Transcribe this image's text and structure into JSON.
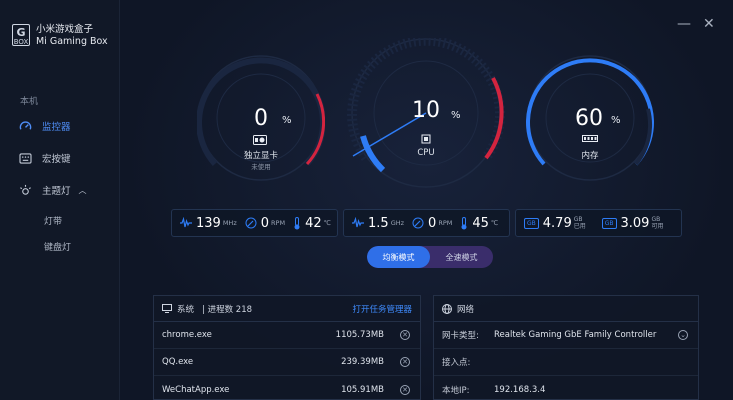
{
  "app": {
    "title_cn": "小米游戏盒子",
    "title_en": "Mi Gaming Box",
    "logo_top": "G",
    "logo_bottom": "BOX"
  },
  "window": {
    "minimize": "—",
    "close": "✕"
  },
  "sidebar": {
    "section": "本机",
    "items": [
      {
        "label": "监控器",
        "icon": "speedometer-icon",
        "active": true
      },
      {
        "label": "宏按键",
        "icon": "keyboard-icon",
        "active": false
      },
      {
        "label": "主题灯",
        "icon": "light-icon",
        "active": false,
        "expanded": true
      }
    ],
    "sub_items": [
      "灯带",
      "键盘灯"
    ]
  },
  "gauges": {
    "gpu": {
      "value": "0",
      "unit": "%",
      "label": "独立显卡",
      "sublabel": "未使用",
      "percent": 0
    },
    "cpu": {
      "value": "10",
      "unit": "%",
      "label": "CPU",
      "percent": 10
    },
    "mem": {
      "value": "60",
      "unit": "%",
      "label": "内存",
      "percent": 60
    }
  },
  "stats": {
    "gpu": {
      "freq": "139",
      "freq_unit": "MHz",
      "rpm": "0",
      "rpm_unit": "RPM",
      "temp": "42",
      "temp_unit": "℃"
    },
    "cpu": {
      "freq": "1.5",
      "freq_unit": "GHz",
      "rpm": "0",
      "rpm_unit": "RPM",
      "temp": "45",
      "temp_unit": "℃"
    },
    "mem": {
      "used": "4.79",
      "used_unit_top": "GB",
      "used_unit_bottom": "已用",
      "avail": "3.09",
      "avail_unit_top": "GB",
      "avail_unit_bottom": "可用",
      "badge": "GB"
    }
  },
  "modes": {
    "balanced": "均衡模式",
    "full": "全速模式"
  },
  "system_panel": {
    "title": "系统",
    "process_label": "| 进程数 218",
    "link": "打开任务管理器",
    "processes": [
      {
        "name": "chrome.exe",
        "mem": "1105.73MB"
      },
      {
        "name": "QQ.exe",
        "mem": "239.39MB"
      },
      {
        "name": "WeChatApp.exe",
        "mem": "105.91MB"
      }
    ]
  },
  "network_panel": {
    "title": "网络",
    "rows": [
      {
        "key": "网卡类型:",
        "value": "Realtek Gaming GbE Family Controller"
      },
      {
        "key": "接入点:",
        "value": ""
      },
      {
        "key": "本地IP:",
        "value": "192.168.3.4"
      }
    ]
  },
  "colors": {
    "accent": "#2f6fe8",
    "blue_arc": "#2e7cf6",
    "red_arc": "#d3243f"
  }
}
